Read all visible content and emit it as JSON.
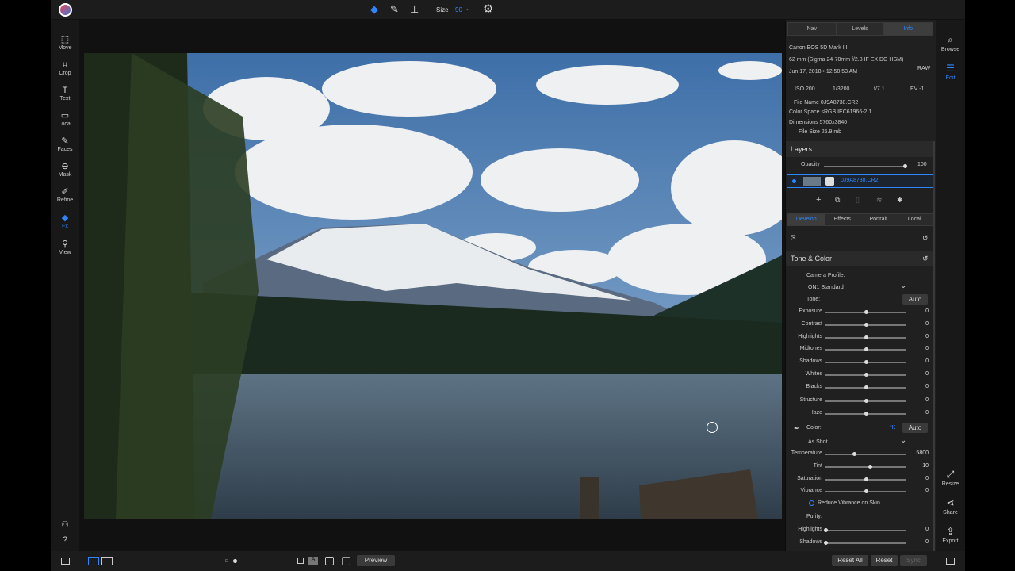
{
  "toolbar": {
    "size_label": "Size",
    "size_value": "90"
  },
  "tools": [
    {
      "label": "Move",
      "icon": "move-icon"
    },
    {
      "label": "Crop",
      "icon": "crop-icon"
    },
    {
      "label": "Text",
      "icon": "text-icon"
    },
    {
      "label": "Local",
      "icon": "local-icon"
    },
    {
      "label": "Faces",
      "icon": "faces-icon"
    },
    {
      "label": "Mask",
      "icon": "mask-icon"
    },
    {
      "label": "Refine",
      "icon": "refine-icon"
    },
    {
      "label": "Fx",
      "icon": "fx-icon"
    },
    {
      "label": "View",
      "icon": "view-icon"
    }
  ],
  "right_tools": {
    "browse": "Browse",
    "edit": "Edit",
    "resize": "Resize",
    "share": "Share",
    "export": "Export"
  },
  "info_tabs": [
    "Nav",
    "Levels",
    "Info"
  ],
  "info": {
    "camera": "Canon EOS 5D Mark III",
    "lens": "62 mm (Sigma 24-70mm f/2.8 IF EX DG HSM)",
    "raw": "RAW",
    "date": "Jun 17, 2018 • 12:50:53 AM",
    "iso": "ISO 200",
    "shutter": "1/3200",
    "aperture": "f/7.1",
    "ev": "EV -1",
    "file_name": "File Name 0J9A8738.CR2",
    "color_space": "Color Space sRGB IEC61966-2.1",
    "dimensions": "Dimensions 5760x3840",
    "file_size": "File Size 25.9 mb"
  },
  "layers": {
    "title": "Layers",
    "opacity_label": "Opacity",
    "opacity_value": "100",
    "layer_name": "0J9A8738.CR2"
  },
  "module_tabs": [
    "Develop",
    "Effects",
    "Portrait",
    "Local"
  ],
  "tone": {
    "title": "Tone & Color",
    "profile_label": "Camera Profile:",
    "profile_value": "ON1 Standard",
    "tone_label": "Tone:",
    "auto": "Auto",
    "color_label": "Color:",
    "k_label": "°K",
    "wb_value": "As Shot",
    "reduce_vibrance": "Reduce Vibrance on Skin",
    "purity_label": "Purity:"
  },
  "sliders": [
    {
      "label": "Exposure",
      "value": "0"
    },
    {
      "label": "Contrast",
      "value": "0"
    },
    {
      "label": "Highlights",
      "value": "0"
    },
    {
      "label": "Midtones",
      "value": "0"
    },
    {
      "label": "Shadows",
      "value": "0"
    },
    {
      "label": "Whites",
      "value": "0"
    },
    {
      "label": "Blacks",
      "value": "0"
    },
    {
      "label": "Structure",
      "value": "0"
    },
    {
      "label": "Haze",
      "value": "0"
    }
  ],
  "color_sliders": [
    {
      "label": "Temperature",
      "value": "5800"
    },
    {
      "label": "Tint",
      "value": "10"
    },
    {
      "label": "Saturation",
      "value": "0"
    },
    {
      "label": "Vibrance",
      "value": "0"
    }
  ],
  "purity_sliders": [
    {
      "label": "Highlights",
      "value": "0"
    },
    {
      "label": "Shadows",
      "value": "0"
    }
  ],
  "bottom": {
    "preview": "Preview",
    "reset_all": "Reset All",
    "reset": "Reset",
    "sync": "Sync"
  }
}
